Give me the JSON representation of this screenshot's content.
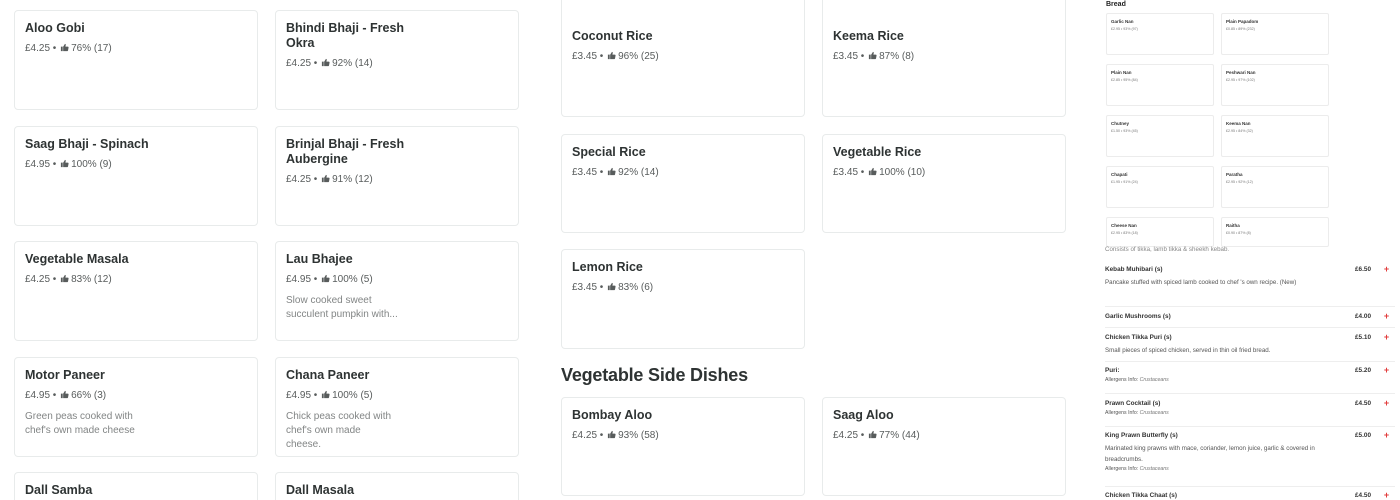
{
  "colors": {
    "card_border": "#e8ebeb",
    "text": "#2e3333",
    "meta": "#585c5c",
    "add_red": "#e23b3b"
  },
  "left_cards": [
    {
      "name": "Aloo Gobi",
      "price": "£4.25",
      "rating": "76% (17)",
      "desc": ""
    },
    {
      "name": "Bhindi Bhaji - Fresh Okra",
      "price": "£4.25",
      "rating": "92% (14)",
      "desc": ""
    },
    {
      "name": "Saag Bhaji - Spinach",
      "price": "£4.95",
      "rating": "100% (9)",
      "desc": ""
    },
    {
      "name": "Brinjal Bhaji - Fresh Aubergine",
      "price": "£4.25",
      "rating": "91% (12)",
      "desc": ""
    },
    {
      "name": "Vegetable Masala",
      "price": "£4.25",
      "rating": "83% (12)",
      "desc": ""
    },
    {
      "name": "Lau Bhajee",
      "price": "£4.95",
      "rating": "100% (5)",
      "desc": "Slow cooked sweet succulent pumpkin with..."
    },
    {
      "name": "Motor Paneer",
      "price": "£4.95",
      "rating": "66% (3)",
      "desc": "Green peas cooked with chef's own made cheese"
    },
    {
      "name": "Chana Paneer",
      "price": "£4.95",
      "rating": "100% (5)",
      "desc": "Chick peas cooked with chef's own made cheese."
    },
    {
      "name": "Dall Samba",
      "price": "",
      "rating": "",
      "desc": ""
    },
    {
      "name": "Dall Masala",
      "price": "",
      "rating": "",
      "desc": ""
    }
  ],
  "rice_cards": [
    {
      "name": "Coconut Rice",
      "price": "£3.45",
      "rating": "96% (25)"
    },
    {
      "name": "Keema Rice",
      "price": "£3.45",
      "rating": "87% (8)"
    },
    {
      "name": "Special Rice",
      "price": "£3.45",
      "rating": "92% (14)"
    },
    {
      "name": "Vegetable Rice",
      "price": "£3.45",
      "rating": "100% (10)"
    },
    {
      "name": "Lemon Rice",
      "price": "£3.45",
      "rating": "83% (6)"
    }
  ],
  "side_section_title": "Vegetable Side Dishes",
  "side_cards": [
    {
      "name": "Bombay Aloo",
      "price": "£4.25",
      "rating": "93% (58)"
    },
    {
      "name": "Saag Aloo",
      "price": "£4.25",
      "rating": "77% (44)"
    }
  ],
  "panel": {
    "bread_title": "Bread",
    "bread_items": [
      {
        "name": "Garlic Nan",
        "meta": "£2.95 • 93% (97)"
      },
      {
        "name": "Plain Papadom",
        "meta": "£0.85 • 89% (232)"
      },
      {
        "name": "Plain Nan",
        "meta": "£2.85 • 95% (84)"
      },
      {
        "name": "Peshwari Nan",
        "meta": "£2.95 • 97% (102)"
      },
      {
        "name": "Chutney",
        "meta": "£1.50 • 93% (45)"
      },
      {
        "name": "Keema Nan",
        "meta": "£2.95 • 84% (32)"
      },
      {
        "name": "Chapati",
        "meta": "£1.95 • 91% (24)"
      },
      {
        "name": "Paratha",
        "meta": "£2.95 • 92% (12)"
      },
      {
        "name": "Cheese Nan",
        "meta": "£2.95 • 83% (18)"
      },
      {
        "name": "Raitha",
        "meta": "£0.90 • 87% (8)"
      }
    ],
    "clip_text": "Consists of tikka, lamb tikka & sheekh kebab.",
    "menu_rows": [
      {
        "title": "Kebab Muhibari (s)",
        "price": "£6.50",
        "desc": "Pancake stuffed with spiced lamb cooked to chef 's own recipe. (New)",
        "allergens": ""
      },
      {
        "title": "Garlic Mushrooms (s)",
        "price": "£4.00",
        "desc": "",
        "allergens": ""
      },
      {
        "title": "Chicken Tikka Puri (s)",
        "price": "£5.10",
        "desc": "Small pieces of spiced chicken, served in thin oil fried bread.",
        "allergens": ""
      },
      {
        "title": "Puri:",
        "price": "£5.20",
        "desc": "",
        "allergens": "Crustaceans"
      },
      {
        "title": "Prawn Cocktail (s)",
        "price": "£4.50",
        "desc": "",
        "allergens": "Crustaceans"
      },
      {
        "title": "King Prawn Butterfly (s)",
        "price": "£5.00",
        "desc": "Marinated king prawns with mace, coriander, lemon juice, garlic & covered in breadcrumbs.",
        "allergens": "Crustaceans"
      },
      {
        "title": "Chicken Tikka Chaat (s)",
        "price": "£4.50",
        "desc": "",
        "allergens": ""
      }
    ],
    "allergens_label": "Allergens Info:",
    "plus_symbol": "+"
  }
}
